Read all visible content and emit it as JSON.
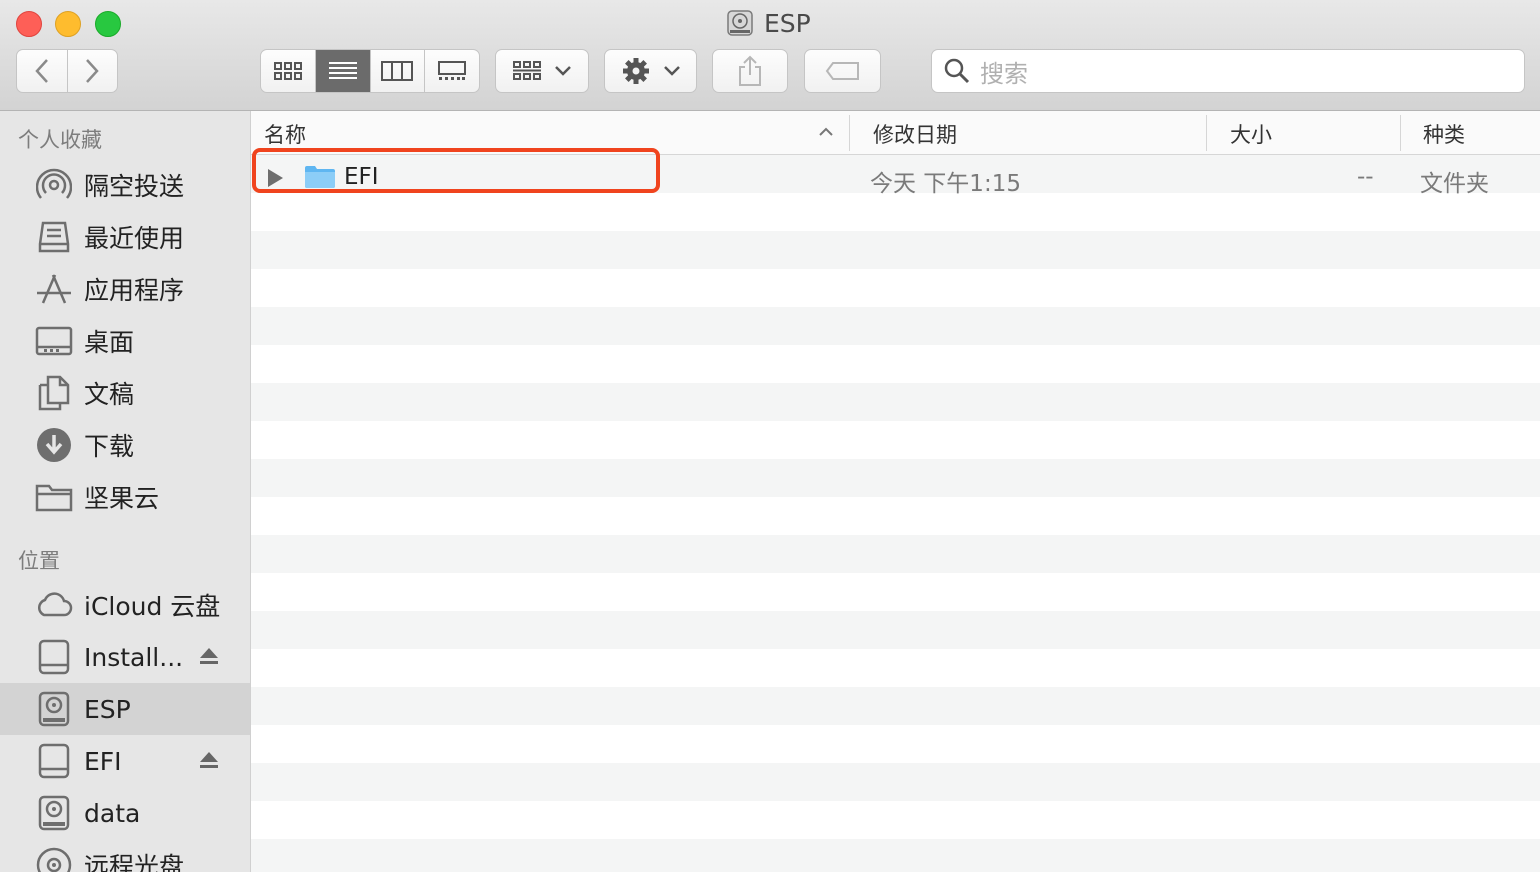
{
  "window": {
    "title": "ESP"
  },
  "toolbar": {
    "search_placeholder": "搜索"
  },
  "sidebar": {
    "favorites_heading": "个人收藏",
    "favorites": [
      {
        "label": "隔空投送",
        "icon": "airdrop-icon"
      },
      {
        "label": "最近使用",
        "icon": "recents-icon"
      },
      {
        "label": "应用程序",
        "icon": "applications-icon"
      },
      {
        "label": "桌面",
        "icon": "desktop-icon"
      },
      {
        "label": "文稿",
        "icon": "documents-icon"
      },
      {
        "label": "下载",
        "icon": "downloads-icon"
      },
      {
        "label": "坚果云",
        "icon": "folder-icon"
      }
    ],
    "locations_heading": "位置",
    "locations": [
      {
        "label": "iCloud 云盘",
        "icon": "icloud-icon"
      },
      {
        "label": "Install...",
        "icon": "external-disk-icon"
      },
      {
        "label": "ESP",
        "icon": "internal-disk-icon",
        "selected": true
      },
      {
        "label": "EFI",
        "icon": "external-disk-icon"
      },
      {
        "label": "data",
        "icon": "internal-disk-icon"
      },
      {
        "label": "远程光盘",
        "icon": "remote-disc-icon"
      }
    ]
  },
  "columns": {
    "name": "名称",
    "date": "修改日期",
    "size": "大小",
    "kind": "种类"
  },
  "files": [
    {
      "name": "EFI",
      "date": "今天 下午1:15",
      "size": "--",
      "kind": "文件夹"
    }
  ],
  "colors": {
    "highlight": "#f0441e",
    "folder": "#5fb6f1"
  }
}
